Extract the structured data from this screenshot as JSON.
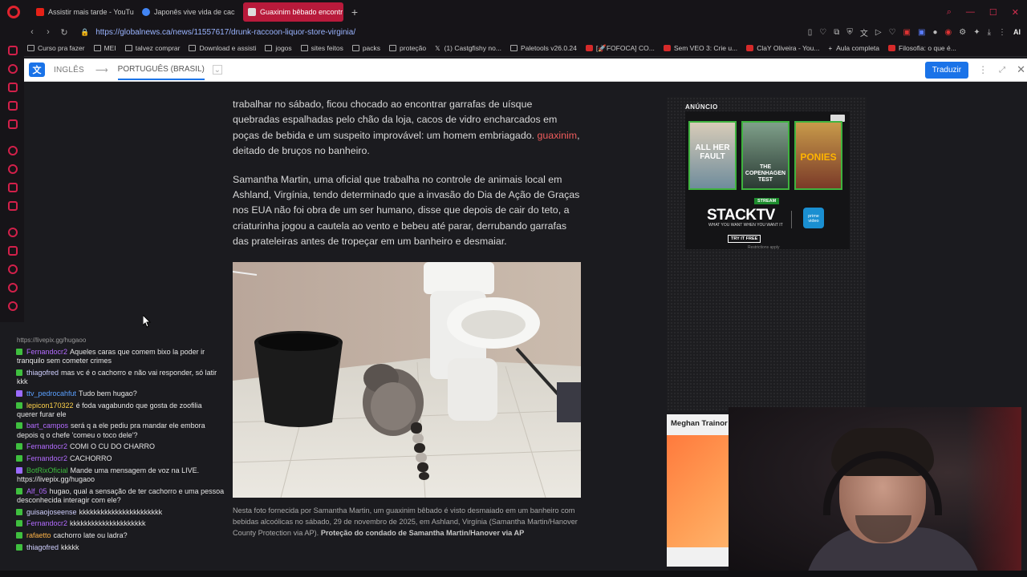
{
  "tabs": [
    {
      "title": "Assistir mais tarde - YouTu",
      "color": "#e62117",
      "active": false
    },
    {
      "title": "Japonês vive vida de cac",
      "color": "#4285f4",
      "active": false
    },
    {
      "title": "Guaxinim bêbado encontr",
      "color": "#c0c0c0",
      "active": true
    }
  ],
  "address": {
    "url": "https://globalnews.ca/news/11557617/drunk-raccoon-liquor-store-virginia/"
  },
  "bookmarks": [
    {
      "label": "Curso pra fazer",
      "icon": "folder-icon"
    },
    {
      "label": "MEI",
      "icon": "folder-icon"
    },
    {
      "label": "talvez comprar",
      "icon": "folder-icon"
    },
    {
      "label": "Download e assisti",
      "icon": "folder-icon"
    },
    {
      "label": "jogos",
      "icon": "folder-icon"
    },
    {
      "label": "sites feitos",
      "icon": "folder-icon"
    },
    {
      "label": "packs",
      "icon": "folder-icon"
    },
    {
      "label": "proteção",
      "icon": "folder-icon"
    },
    {
      "label": "(1) Castgfishy no...",
      "icon": "x-icon"
    },
    {
      "label": "Paletools v26.0.24",
      "icon": "page-icon"
    },
    {
      "label": "[🚀FOFOCA] CO...",
      "icon": "youtube-icon"
    },
    {
      "label": "Sem VEO 3: Crie u...",
      "icon": "youtube-icon"
    },
    {
      "label": "ClaY Oliveira - You...",
      "icon": "youtube-icon"
    },
    {
      "label": "Aula completa",
      "icon": "plus-icon"
    },
    {
      "label": "Filosofia: o que é...",
      "icon": "youtube-icon"
    }
  ],
  "translate": {
    "source": "INGLÊS",
    "target": "PORTUGUÊS (BRASIL)",
    "button": "Traduzir"
  },
  "article": {
    "p1_a": "trabalhar no sábado, ficou chocado ao encontrar garrafas de uísque quebradas espalhadas pelo chão da loja, cacos de vidro encharcados em poças de bebida e um suspeito improvável: um homem embriagado.",
    "p1_link": "guaxinim",
    "p1_b": ", deitado de bruços no banheiro.",
    "p2": "Samantha Martin, uma oficial que trabalha no controle de animais local em Ashland, Virgínia, tendo determinado que a invasão do Dia de Ação de Graças nos EUA não foi obra de um ser humano, disse que depois de cair do teto, a criaturinha jogou a cautela ao vento e bebeu até parar, derrubando garrafas das prateleiras antes de tropeçar em um banheiro e desmaiar.",
    "caption_text": "Nesta foto fornecida por Samantha Martin, um guaxinim bêbado é visto desmaiado em um banheiro com bebidas alcoólicas no sábado, 29 de novembro de 2025, em Ashland, Virgínia (Samantha Martin/Hanover County Protection via AP).",
    "caption_credit": "Proteção do condado de Samantha Martin/Hanover via AP"
  },
  "ad": {
    "label": "ANÚNCIO",
    "posters": [
      "ALL HER FAULT",
      "THE COPENHAGEN TEST",
      "PONIES"
    ],
    "stream": "STREAM",
    "brand": "STACKTV",
    "tagline": "WHAT YOU WANT WHEN YOU WANT IT",
    "prime": "prime video",
    "cta": "TRY IT FREE",
    "fineprint": "Restrictions apply"
  },
  "video": {
    "title": "Meghan Trainor"
  },
  "chat": {
    "top": "https://livepix.gg/hugaoo",
    "messages": [
      {
        "user": "Fernandocr2",
        "color": "#b36bff",
        "badge": "#3fbf3f",
        "text": "Aqueles caras que comem bixo la poder ir tranquilo sem cometer crimes"
      },
      {
        "user": "thiagofred",
        "color": "#d0d0ff",
        "badge": "#3fbf3f",
        "text": "mas vc é o cachorro e não vai responder, só latir kkk"
      },
      {
        "user": "ttv_pedrocahfut",
        "color": "#5aa0ff",
        "badge": "#9b6bff",
        "text": "Tudo bem hugao?"
      },
      {
        "user": "lepicon170322",
        "color": "#ffd24a",
        "badge": "#3fbf3f",
        "text": "é foda vagabundo que gosta de zoofilia querer furar ele"
      },
      {
        "user": "bart_campos",
        "color": "#b36bff",
        "badge": "#3fbf3f",
        "text": "será q a ele pediu pra mandar ele embora depois q o chefe 'comeu o toco dele'?"
      },
      {
        "user": "Fernandocr2",
        "color": "#b36bff",
        "badge": "#3fbf3f",
        "text": "COMI O CU DO CHARRO"
      },
      {
        "user": "Fernandocr2",
        "color": "#b36bff",
        "badge": "#3fbf3f",
        "text": "CACHORRO"
      },
      {
        "user": "BotRixOficial",
        "color": "#3fbf3f",
        "badge": "#9b6bff",
        "text": "Mande uma mensagem de voz na LIVE. https://livepix.gg/hugaoo"
      },
      {
        "user": "Alf_05",
        "color": "#b36bff",
        "badge": "#3fbf3f",
        "text": "hugao, qual a sensação de ter cachorro e uma pessoa desconhecida interagir com ele?"
      },
      {
        "user": "guisaojoseense",
        "color": "#d0d0ff",
        "badge": "#3fbf3f",
        "text": "kkkkkkkkkkkkkkkkkkkkkkk"
      },
      {
        "user": "Fernandocr2",
        "color": "#b36bff",
        "badge": "#3fbf3f",
        "text": "kkkkkkkkkkkkkkkkkkkkk"
      },
      {
        "user": "rafaetto",
        "color": "#ffb347",
        "badge": "#3fbf3f",
        "text": "cachorro late ou ladra?"
      },
      {
        "user": "thiagofred",
        "color": "#d0d0ff",
        "badge": "#3fbf3f",
        "text": "kkkkk"
      }
    ]
  }
}
